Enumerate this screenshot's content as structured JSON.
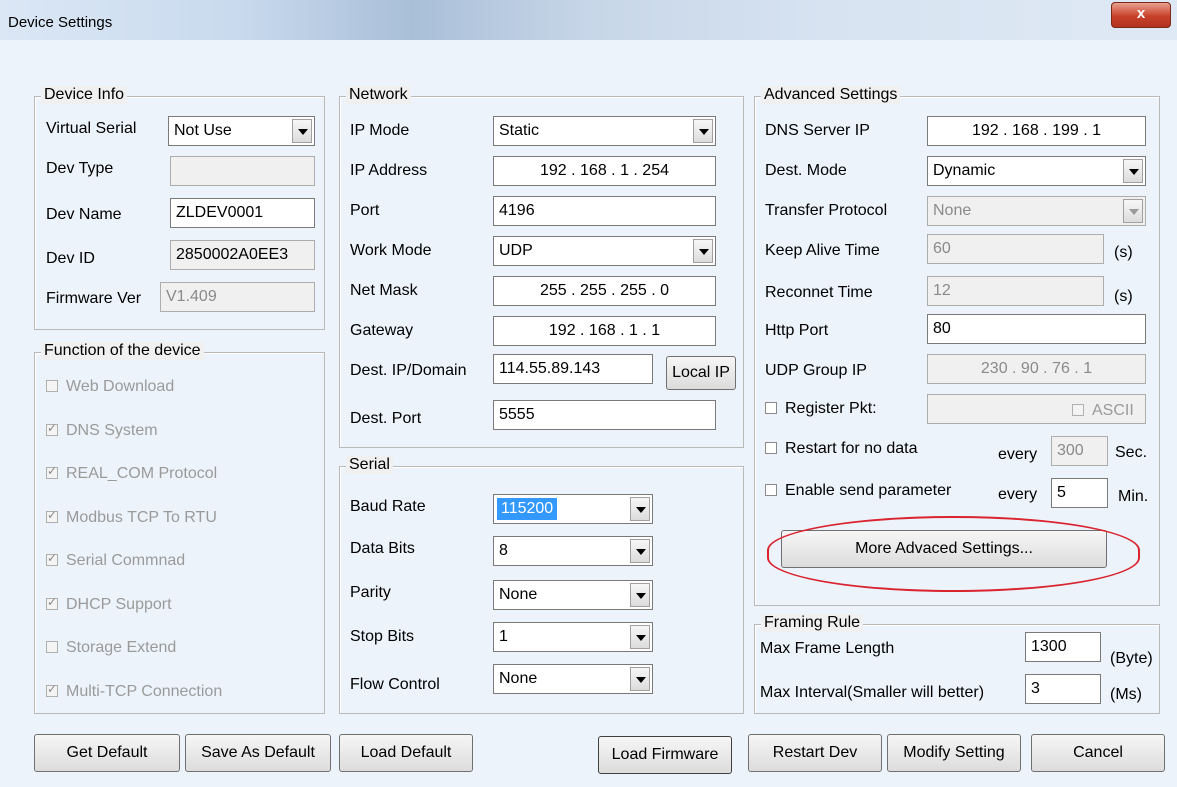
{
  "window": {
    "title": "Device Settings",
    "close_label": "x"
  },
  "device_info": {
    "legend": "Device Info",
    "virtual_serial_label": "Virtual Serial",
    "virtual_serial_value": "Not Use",
    "dev_type_label": "Dev Type",
    "dev_type_value": "",
    "dev_name_label": "Dev Name",
    "dev_name_value": "ZLDEV0001",
    "dev_id_label": "Dev ID",
    "dev_id_value": "2850002A0EE3",
    "firmware_label": "Firmware Ver",
    "firmware_value": "V1.409"
  },
  "functions": {
    "legend": "Function of the device",
    "items": [
      {
        "label": "Web Download",
        "checked": false
      },
      {
        "label": "DNS System",
        "checked": true
      },
      {
        "label": "REAL_COM Protocol",
        "checked": true
      },
      {
        "label": "Modbus TCP To RTU",
        "checked": true
      },
      {
        "label": "Serial Commnad",
        "checked": true
      },
      {
        "label": "DHCP Support",
        "checked": true
      },
      {
        "label": "Storage Extend",
        "checked": false
      },
      {
        "label": "Multi-TCP Connection",
        "checked": true
      }
    ]
  },
  "network": {
    "legend": "Network",
    "ip_mode_label": "IP Mode",
    "ip_mode_value": "Static",
    "ip_address_label": "IP Address",
    "ip_address_value": "192 . 168 .  1  . 254",
    "port_label": "Port",
    "port_value": "4196",
    "work_mode_label": "Work Mode",
    "work_mode_value": "UDP",
    "net_mask_label": "Net Mask",
    "net_mask_value": "255 . 255 . 255 .  0",
    "gateway_label": "Gateway",
    "gateway_value": "192 . 168 .  1  .  1",
    "dest_ip_label": "Dest. IP/Domain",
    "dest_ip_value": "114.55.89.143",
    "local_ip_button": "Local IP",
    "dest_port_label": "Dest. Port",
    "dest_port_value": "5555"
  },
  "serial": {
    "legend": "Serial",
    "baud_label": "Baud Rate",
    "baud_value": "115200",
    "data_bits_label": "Data Bits",
    "data_bits_value": "8",
    "parity_label": "Parity",
    "parity_value": "None",
    "stop_bits_label": "Stop Bits",
    "stop_bits_value": "1",
    "flow_label": "Flow Control",
    "flow_value": "None"
  },
  "advanced": {
    "legend": "Advanced Settings",
    "dns_label": "DNS Server IP",
    "dns_value": "192 . 168 . 199 .  1",
    "dest_mode_label": "Dest. Mode",
    "dest_mode_value": "Dynamic",
    "transfer_label": "Transfer Protocol",
    "transfer_value": "None",
    "keep_alive_label": "Keep Alive Time",
    "keep_alive_value": "60",
    "keep_alive_unit": "(s)",
    "reconnect_label": "Reconnet Time",
    "reconnect_value": "12",
    "reconnect_unit": "(s)",
    "http_port_label": "Http Port",
    "http_port_value": "80",
    "udp_group_label": "UDP Group IP",
    "udp_group_value": "230 .  90 .  76 .  1",
    "register_label": "Register Pkt:",
    "register_value": "",
    "ascii_label": "ASCII",
    "restart_label": "Restart for no data",
    "restart_every": "every",
    "restart_value": "300",
    "restart_unit": "Sec.",
    "enable_label": "Enable send parameter",
    "enable_every": "every",
    "enable_value": "5",
    "enable_unit": "Min.",
    "more_button": "More Advaced Settings..."
  },
  "framing": {
    "legend": "Framing Rule",
    "max_frame_label": "Max Frame Length",
    "max_frame_value": "1300",
    "max_frame_unit": "(Byte)",
    "max_interval_label": "Max Interval(Smaller will better)",
    "max_interval_value": "3",
    "max_interval_unit": "(Ms)"
  },
  "buttons": {
    "get_default": "Get Default",
    "save_as_default": "Save As Default",
    "load_default": "Load Default",
    "load_firmware": "Load Firmware",
    "restart_dev": "Restart Dev",
    "modify_setting": "Modify Setting",
    "cancel": "Cancel"
  },
  "colors": {
    "highlight": "#d9232e",
    "selection": "#3399ff"
  }
}
